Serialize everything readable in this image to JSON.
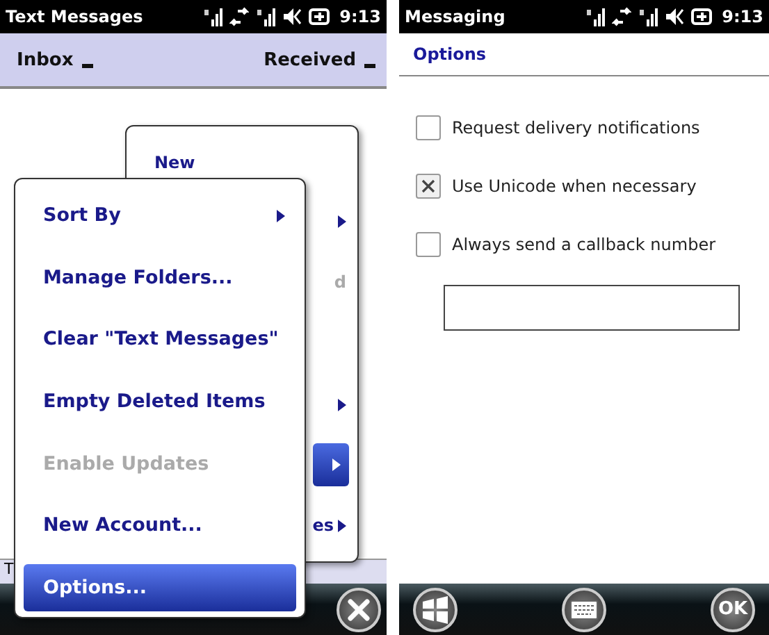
{
  "left_screen": {
    "title": "Text Messages",
    "time": "9:13",
    "menu_bar": {
      "left": "Inbox",
      "right": "Received"
    },
    "back_menu": [
      {
        "label": "New",
        "kind": "full",
        "submenu": false,
        "selected": false
      },
      {
        "kind": "hidden",
        "submenu": true,
        "selected": false
      },
      {
        "label": "d",
        "kind": "greyed",
        "submenu": false,
        "selected": false
      },
      {
        "kind": "hidden",
        "submenu": true,
        "selected": false
      },
      {
        "kind": "hidden",
        "submenu": true,
        "selected": true
      },
      {
        "label": "es",
        "kind": "clipped",
        "submenu": true,
        "selected": false
      }
    ],
    "front_menu": [
      {
        "label": "Sort By",
        "submenu": true,
        "disabled": false,
        "selected": false
      },
      {
        "label": "Manage Folders...",
        "submenu": false,
        "disabled": false,
        "selected": false
      },
      {
        "label": "Clear \"Text Messages\"",
        "submenu": false,
        "disabled": false,
        "selected": false
      },
      {
        "label": "Empty Deleted Items",
        "submenu": false,
        "disabled": false,
        "selected": false
      },
      {
        "label": "Enable Updates",
        "submenu": false,
        "disabled": true,
        "selected": false
      },
      {
        "label": "New Account...",
        "submenu": false,
        "disabled": false,
        "selected": false
      },
      {
        "label": "Options...",
        "submenu": false,
        "disabled": false,
        "selected": true
      }
    ],
    "strip_text": "T"
  },
  "right_screen": {
    "title": "Messaging",
    "time": "9:13",
    "heading": "Options",
    "options": [
      {
        "label": "Request delivery notifications",
        "checked": false
      },
      {
        "label": "Use Unicode when necessary",
        "checked": true
      },
      {
        "label": "Always send a callback number",
        "checked": false
      }
    ],
    "ok_button": "OK"
  }
}
